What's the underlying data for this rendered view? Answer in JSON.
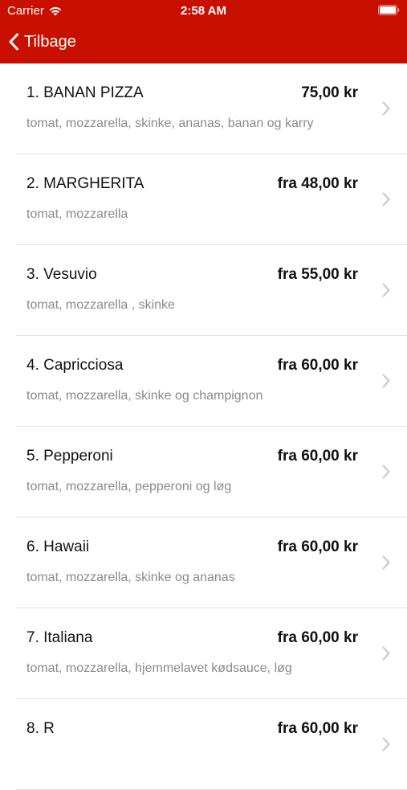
{
  "status_bar": {
    "carrier": "Carrier",
    "time": "2:58 AM"
  },
  "nav": {
    "back_label": "Tilbage"
  },
  "menu": {
    "items": [
      {
        "name": "1. BANAN PIZZA",
        "price": "75,00 kr",
        "description": "tomat, mozzarella, skinke, ananas, banan og karry"
      },
      {
        "name": "2. MARGHERITA",
        "price": "fra 48,00 kr",
        "description": "tomat, mozzarella"
      },
      {
        "name": "3. Vesuvio",
        "price": "fra 55,00 kr",
        "description": "tomat, mozzarella , skinke"
      },
      {
        "name": "4. Capricciosa",
        "price": "fra 60,00 kr",
        "description": "tomat, mozzarella, skinke og champignon"
      },
      {
        "name": "5. Pepperoni",
        "price": "fra 60,00 kr",
        "description": "tomat, mozzarella, pepperoni og løg"
      },
      {
        "name": "6. Hawaii",
        "price": "fra 60,00 kr",
        "description": "tomat, mozzarella, skinke og ananas"
      },
      {
        "name": "7. Italiana",
        "price": "fra 60,00 kr",
        "description": "tomat, mozzarella, hjemmelavet kødsauce, løg"
      },
      {
        "name": "8. R",
        "price": "fra 60,00 kr",
        "description": ""
      }
    ]
  },
  "colors": {
    "header_background": "#c91000",
    "header_text": "#ffffff",
    "description_text": "#8a8a8e",
    "separator": "#e3e3e6",
    "chevron": "#c4c4c7"
  }
}
